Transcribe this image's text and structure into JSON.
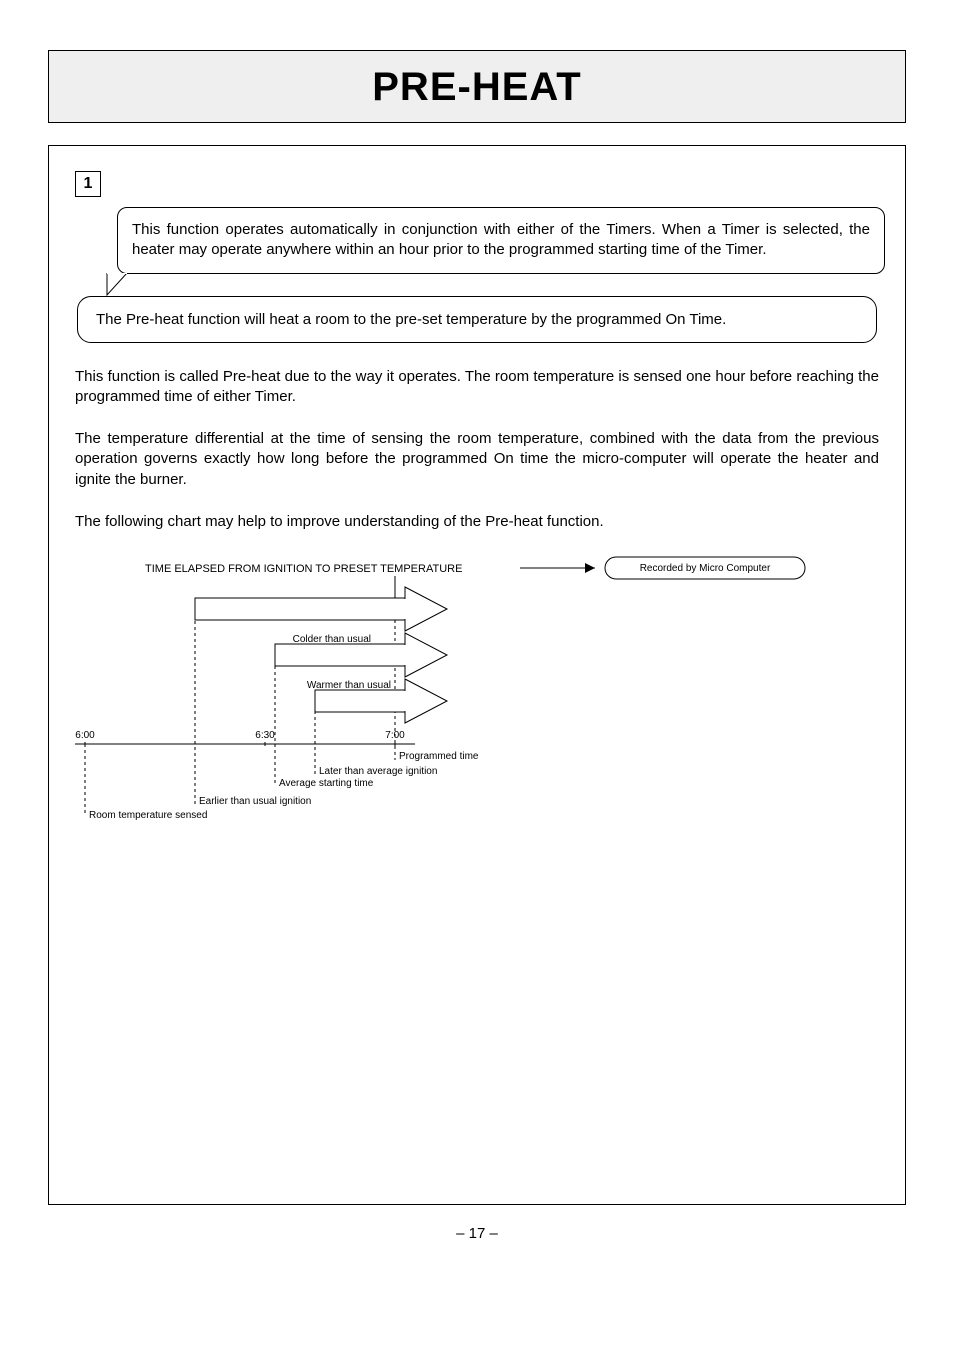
{
  "title": "PRE-HEAT",
  "section_number": "1",
  "callout_text": "This function operates automatically in conjunction with either of the Timers.  When a Timer is selected, the heater may operate anywhere within an hour prior to the programmed starting time of the Timer.",
  "lozenge_text": "The Pre-heat function will heat a room to the pre-set temperature by the programmed On Time.",
  "paragraph_1": "This function is called Pre-heat due to the way it operates.  The room temperature is sensed one hour before reaching the programmed time of either Timer.",
  "paragraph_2": "The temperature differential at the time of sensing the room temperature, combined with the data from the previous operation governs exactly how long before the programmed On time the micro-computer will operate the heater and ignite the burner.",
  "paragraph_3": "The following chart may help to improve understanding of the Pre-heat function.",
  "chart_data": {
    "type": "diagram",
    "top_label": "TIME ELAPSED  FROM IGNITION TO PRESET TEMPERATURE",
    "badge_right": "Recorded by Micro Computer",
    "arrow_colder_label": "Colder than usual",
    "arrow_warmer_label": "Warmer than usual",
    "time_ticks": [
      "6:00",
      "6:30",
      "7:00"
    ],
    "below_labels": [
      "Programmed time",
      "Later than average ignition",
      "Average starting time",
      "Earlier than usual ignition",
      "Room temperature sensed"
    ]
  },
  "page_number": "– 17 –"
}
